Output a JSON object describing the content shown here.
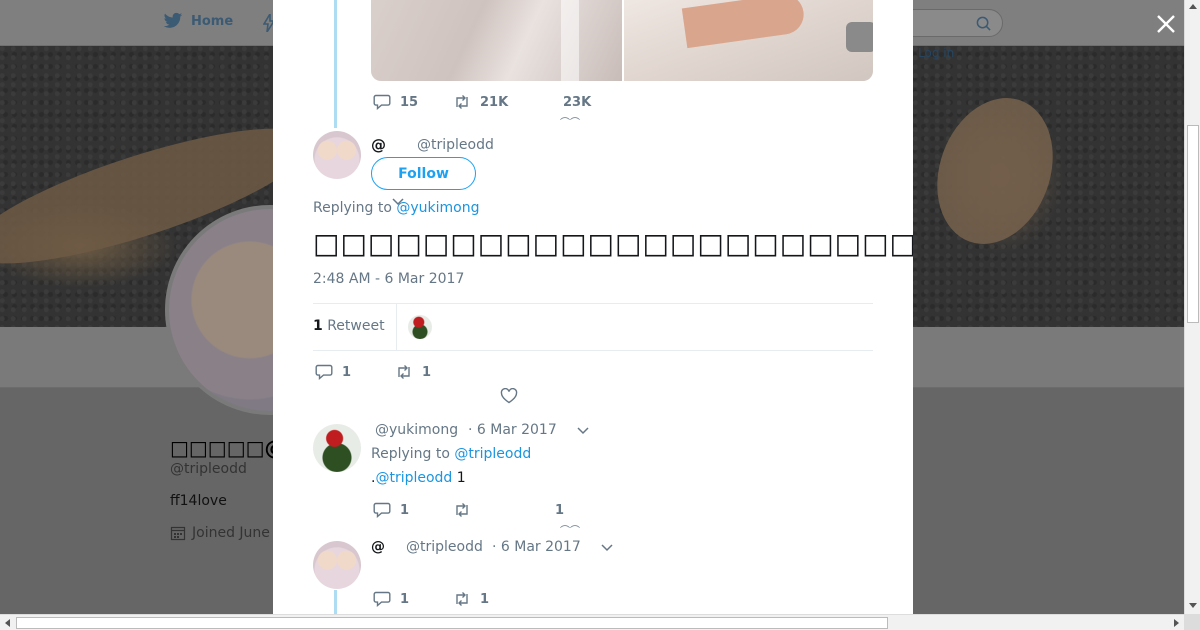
{
  "background": {
    "nav": {
      "home_label": "Home"
    },
    "login_label": "Log in",
    "profile": {
      "name": "□□□□□@□□□",
      "handle": "@tripleodd",
      "bio": "ff14love",
      "joined": "Joined June"
    }
  },
  "modal": {
    "prev_tweet_actions": {
      "replies": "15",
      "retweets": "21K",
      "likes": "23K"
    },
    "main_tweet": {
      "name": "@",
      "handle": "@tripleodd",
      "follow_label": "Follow",
      "replying_prefix": "Replying to",
      "replying_to": "@yukimong",
      "text": "□□□□□□□□□□□□□□□□□□□□□□□□□□□□□□□□□",
      "timestamp": "2:48 AM - 6 Mar 2017",
      "retweet_count": "1",
      "retweet_label": "Retweet",
      "actions": {
        "replies": "1",
        "retweets": "1"
      }
    },
    "reply_1": {
      "handle": "@yukimong",
      "time": "· 6 Mar 2017",
      "replying_prefix": "Replying to",
      "replying_to": "@tripleodd",
      "text_prefix": ".",
      "mention": "@tripleodd",
      "text_suffix": " 1",
      "actions": {
        "replies": "1",
        "likes": "1"
      }
    },
    "reply_2": {
      "name": "@",
      "handle": "@tripleodd",
      "time": "· 6 Mar 2017",
      "actions": {
        "replies": "1",
        "retweets": "1"
      }
    }
  },
  "colors": {
    "accent": "#1da1f2",
    "link": "#1b95e0",
    "muted": "#657786",
    "thread": "#aedcf3"
  }
}
